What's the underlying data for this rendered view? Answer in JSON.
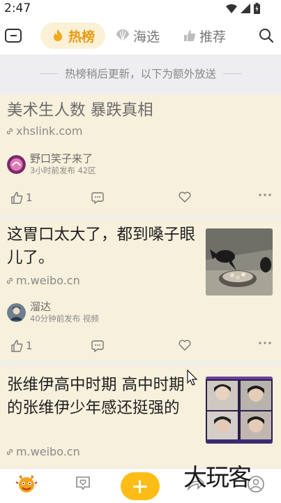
{
  "status": {
    "time": "2:47"
  },
  "tabs": [
    {
      "label": "热榜",
      "icon": "flame-icon",
      "active": true
    },
    {
      "label": "海选",
      "icon": "shell-icon",
      "active": false
    },
    {
      "label": "推荐",
      "icon": "thumbs-up-icon",
      "active": false
    }
  ],
  "notice": "热榜稍后更新，以下为额外放送",
  "cards": [
    {
      "title": "美术生人数 暴跌真相",
      "link": "xhslink.com",
      "author": "野口笑子来了",
      "meta": "3小时前发布  42区",
      "likes": "1"
    },
    {
      "title": "这胃口太大了，都到嗓子眼儿了。",
      "link": "m.weibo.cn",
      "author": "溜达",
      "meta": "40分钟前发布  视频",
      "likes": "1"
    },
    {
      "title": "张维伊高中时期   高中时期的张维伊少年感还挺强的",
      "link": "m.weibo.cn"
    }
  ],
  "watermark": "大玩客",
  "colors": {
    "accent": "#e89a12",
    "card_bg": "#f6f0dc",
    "plus_button": "#fdbd16"
  }
}
